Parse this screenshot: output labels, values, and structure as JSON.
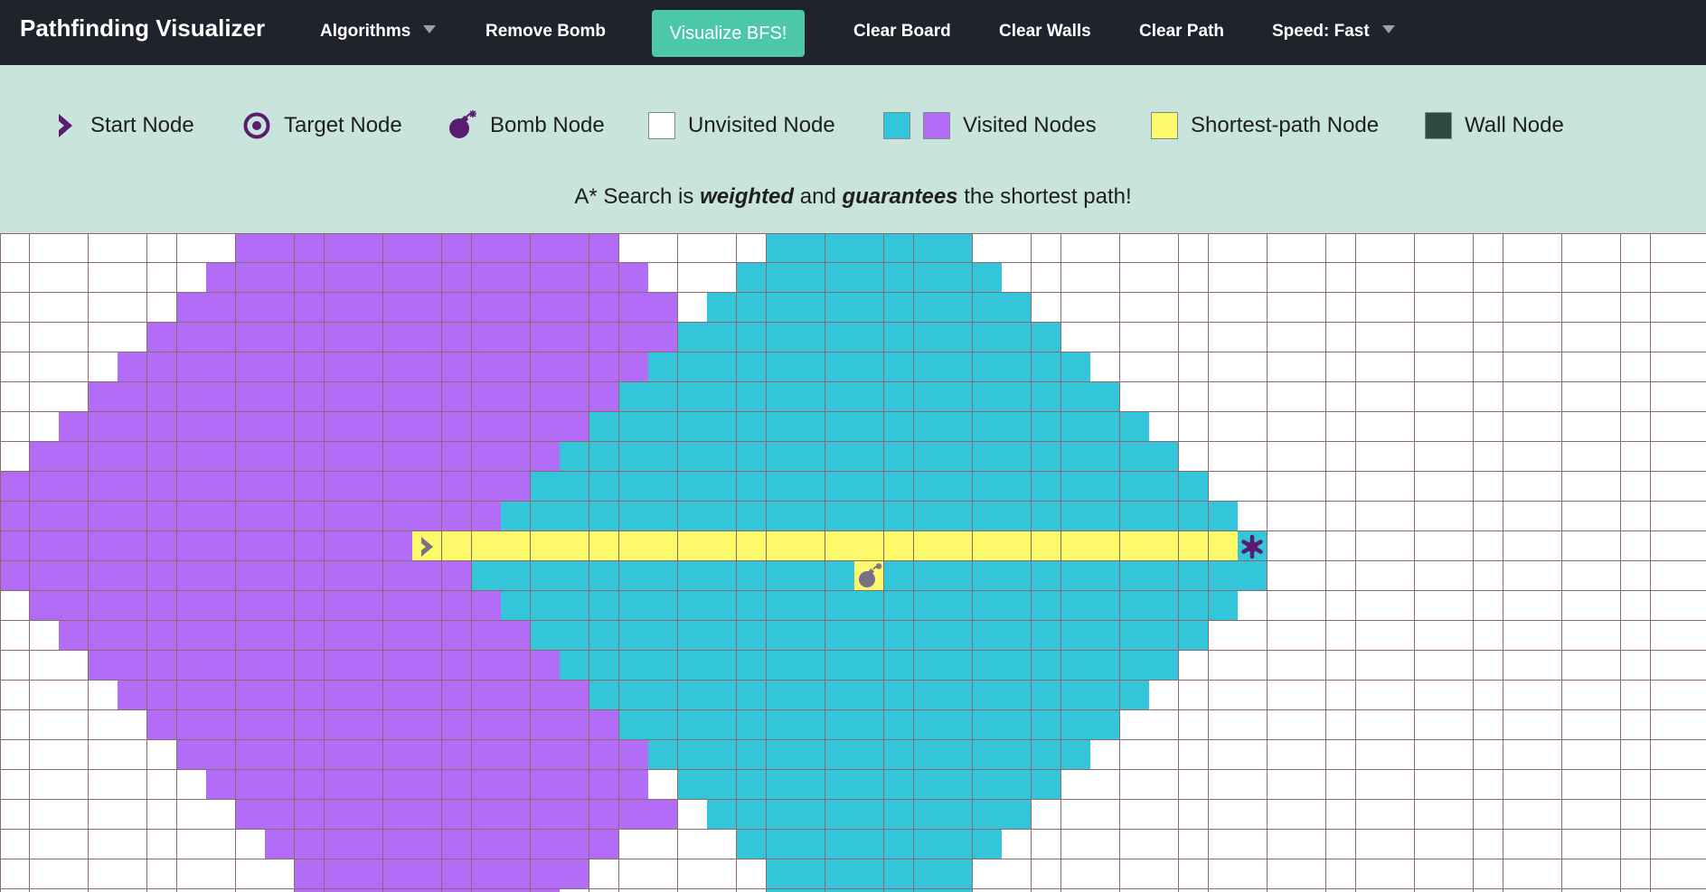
{
  "nav": {
    "title": "Pathfinding Visualizer",
    "algorithms": "Algorithms",
    "remove_bomb": "Remove Bomb",
    "visualize": "Visualize BFS!",
    "clear_board": "Clear Board",
    "clear_walls": "Clear Walls",
    "clear_path": "Clear Path",
    "speed": "Speed: Fast"
  },
  "legend": {
    "start": "Start Node",
    "target": "Target Node",
    "bomb": "Bomb Node",
    "unvisited": "Unvisited Node",
    "visited": "Visited Nodes",
    "shortest": "Shortest-path Node",
    "wall": "Wall Node"
  },
  "description": {
    "prefix": "A* Search is ",
    "w1": "weighted",
    "mid": " and ",
    "w2": "guarantees",
    "suffix": " the shortest path!"
  },
  "colors": {
    "navbar": "#20232c",
    "accent": "#4cc7a9",
    "legend_bg": "#c9e4dc",
    "unvisited": "#ffffff",
    "visited_purple": "#b36cf5",
    "visited_blue": "#33c6da",
    "shortest_path": "#fcfa6a",
    "wall": "#2f4a3f",
    "grid_line": "#8a6a6f",
    "node_icon": "#5a1d6e"
  },
  "icons": {
    "start": "chevron-right-icon",
    "target": "target-icon",
    "bomb": "bomb-icon"
  },
  "grid": {
    "rows": 23,
    "cols": 58,
    "start_cell": [
      10,
      14
    ],
    "target_cell": [
      10,
      42
    ],
    "bomb_cell": [
      11,
      29
    ],
    "shortest_path": {
      "row": 10,
      "from_col": 15,
      "to_col": 41
    },
    "visited_purple_ranges": [
      [
        8,
        20
      ],
      [
        7,
        21
      ],
      [
        6,
        22
      ],
      [
        5,
        22
      ],
      [
        4,
        21
      ],
      [
        3,
        20
      ],
      [
        2,
        19
      ],
      [
        1,
        18
      ],
      [
        0,
        17
      ],
      [
        0,
        16
      ],
      [
        0,
        14
      ],
      [
        0,
        15
      ],
      [
        1,
        16
      ],
      [
        2,
        17
      ],
      [
        3,
        18
      ],
      [
        4,
        19
      ],
      [
        5,
        20
      ],
      [
        6,
        21
      ],
      [
        7,
        21
      ],
      [
        8,
        22
      ],
      [
        9,
        20
      ],
      [
        10,
        19
      ],
      [
        10,
        18
      ]
    ],
    "visited_blue_ranges": [
      [
        26,
        32
      ],
      [
        25,
        33
      ],
      [
        24,
        34
      ],
      [
        23,
        35
      ],
      [
        22,
        36
      ],
      [
        21,
        37
      ],
      [
        20,
        38
      ],
      [
        19,
        39
      ],
      [
        18,
        40
      ],
      [
        17,
        41
      ],
      [
        42,
        42
      ],
      [
        16,
        42
      ],
      [
        16,
        41
      ],
      [
        18,
        40
      ],
      [
        19,
        39
      ],
      [
        20,
        38
      ],
      [
        21,
        37
      ],
      [
        22,
        36
      ],
      [
        23,
        35
      ],
      [
        24,
        34
      ],
      [
        25,
        33
      ],
      [
        26,
        32
      ],
      [
        26,
        32
      ]
    ]
  }
}
